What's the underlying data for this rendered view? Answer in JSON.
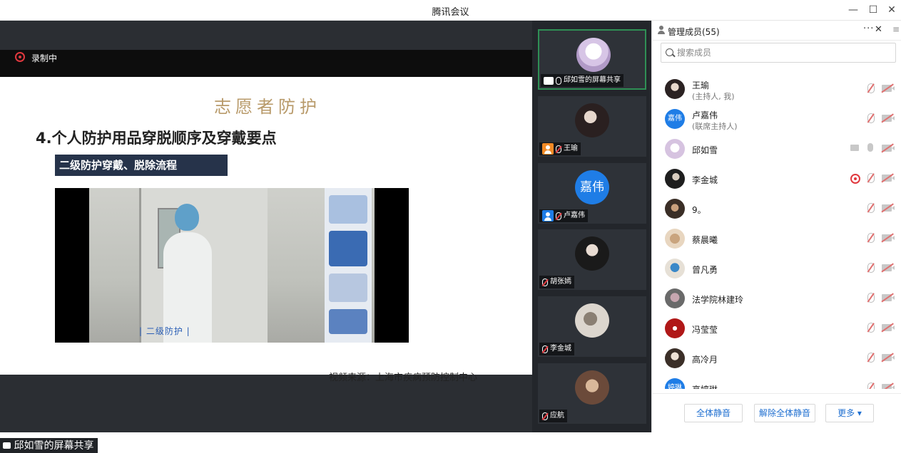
{
  "window": {
    "title": "腾讯会议"
  },
  "share": {
    "recording_label": "录制中",
    "slide": {
      "header": "志愿者防护",
      "title": "4.个人防护用品穿脱顺序及穿戴要点",
      "subtitle": "二级防护穿戴、脱除流程",
      "video_caption": "| 二级防护 |",
      "source": "视频来源：上海市疾病预防控制中心"
    },
    "bottom_label": "邱如雪的屏幕共享"
  },
  "tiles": [
    {
      "label": "邱如雪的屏幕共享",
      "type": "share"
    },
    {
      "label": "王瑜",
      "type": "user-orange"
    },
    {
      "label": "卢嘉伟",
      "type": "user-blue",
      "avatar_text": "嘉伟"
    },
    {
      "label": "胡张嫣",
      "type": "mic"
    },
    {
      "label": "李金城",
      "type": "mic"
    },
    {
      "label": "应航",
      "type": "mic"
    }
  ],
  "members_panel": {
    "title": "管理成员(55)",
    "search_placeholder": "搜索成员",
    "members": [
      {
        "name": "王瑜",
        "role": "(主持人, 我)"
      },
      {
        "name": "卢嘉伟",
        "role": "(联席主持人)",
        "avatar_text": "嘉伟"
      },
      {
        "name": "邱如雪",
        "role": ""
      },
      {
        "name": "李金城",
        "role": ""
      },
      {
        "name": "9。",
        "role": ""
      },
      {
        "name": "蔡晨曦",
        "role": ""
      },
      {
        "name": "曾凡勇",
        "role": ""
      },
      {
        "name": "法学院林建玲",
        "role": ""
      },
      {
        "name": "冯莹莹",
        "role": ""
      },
      {
        "name": "高冷月",
        "role": ""
      },
      {
        "name": "高婷琳",
        "role": "",
        "avatar_text": "婷琳"
      }
    ],
    "footer": {
      "mute_all": "全体静音",
      "unmute_all": "解除全体静音",
      "more": "更多 ▾"
    }
  },
  "colors": {
    "accent": "#1f7de6",
    "record_red": "#e0383e",
    "active_border": "#2f8f55"
  }
}
